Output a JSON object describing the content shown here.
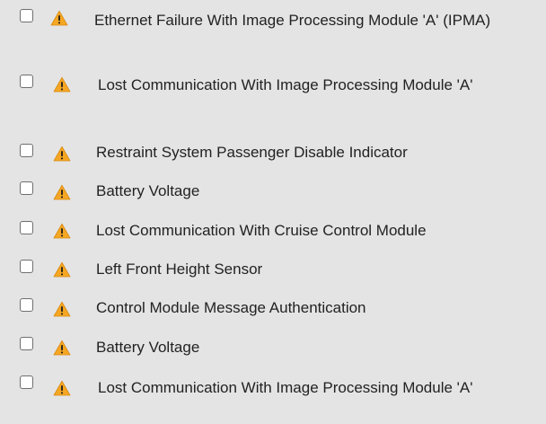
{
  "colors": {
    "background": "#e4e4e4",
    "warning_fill": "#f5a623",
    "warning_glyph": "#1a1a1a",
    "text": "#222222",
    "checkbox_border": "#6f6f6f"
  },
  "dtc_list": {
    "items": [
      {
        "checked": false,
        "icon": "warning-icon",
        "label": "Ethernet Failure With Image Processing Module 'A' (IPMA)"
      },
      {
        "checked": false,
        "icon": "warning-icon",
        "label": "Lost Communication With Image Processing Module 'A'"
      },
      {
        "checked": false,
        "icon": "warning-icon",
        "label": "Restraint System Passenger Disable Indicator"
      },
      {
        "checked": false,
        "icon": "warning-icon",
        "label": "Battery Voltage"
      },
      {
        "checked": false,
        "icon": "warning-icon",
        "label": "Lost Communication With Cruise Control Module"
      },
      {
        "checked": false,
        "icon": "warning-icon",
        "label": "Left Front Height Sensor"
      },
      {
        "checked": false,
        "icon": "warning-icon",
        "label": "Control Module Message Authentication"
      },
      {
        "checked": false,
        "icon": "warning-icon",
        "label": "Battery Voltage"
      },
      {
        "checked": false,
        "icon": "warning-icon",
        "label": "Lost Communication With Image Processing Module 'A'"
      }
    ]
  }
}
